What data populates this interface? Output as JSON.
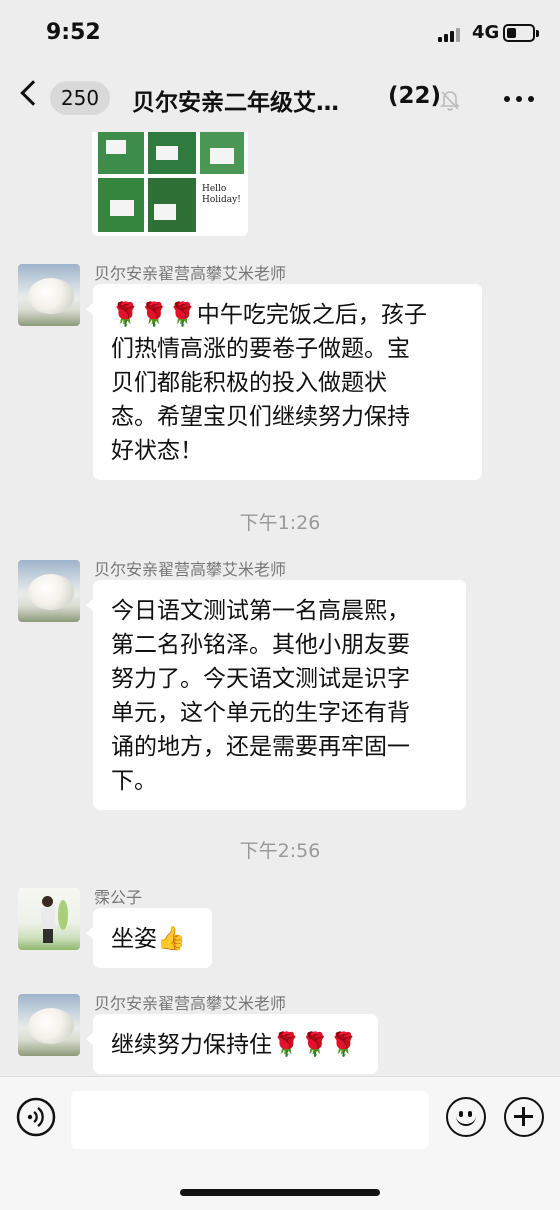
{
  "status_bar": {
    "time": "9:52",
    "network": "4G"
  },
  "nav": {
    "unread_badge": "250",
    "title": "贝尔安亲二年级艾…",
    "member_count": "(22)",
    "icons": [
      "back-chevron-icon",
      "mute-bell-icon",
      "more-dots-icon"
    ]
  },
  "messages": [
    {
      "type": "image",
      "sender": "",
      "caption": "Hello Holiday!"
    },
    {
      "type": "text",
      "sender": "贝尔安亲翟营高攀艾米老师",
      "lines": [
        "🌹🌹🌹中午吃完饭之后，孩子",
        "们热情高涨的要卷子做题。宝",
        "贝们都能积极的投入做题状",
        "态。希望宝贝们继续努力保持",
        "好状态！"
      ]
    },
    {
      "type": "time",
      "text": "下午1:26"
    },
    {
      "type": "text",
      "sender": "贝尔安亲翟营高攀艾米老师",
      "lines": [
        "今日语文测试第一名高晨熙，",
        "第二名孙铭泽。其他小朋友要",
        "努力了。今天语文测试是识字",
        "单元，这个单元的生字还有背",
        "诵的地方，还是需要再牢固一",
        "下。"
      ]
    },
    {
      "type": "time",
      "text": "下午2:56"
    },
    {
      "type": "text",
      "sender": "霂公子",
      "lines": [
        "坐姿👍"
      ]
    },
    {
      "type": "text",
      "sender": "贝尔安亲翟营高攀艾米老师",
      "lines": [
        "继续努力保持住🌹🌹🌹"
      ]
    }
  ],
  "input_bar": {
    "icons": [
      "voice-icon",
      "emoji-icon",
      "plus-icon"
    ]
  }
}
